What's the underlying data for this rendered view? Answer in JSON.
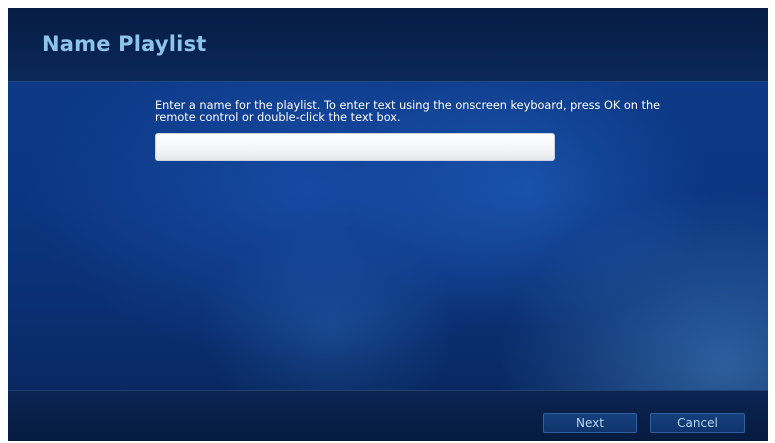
{
  "header": {
    "title": "Name Playlist"
  },
  "main": {
    "instructions": "Enter a name for the playlist. To enter text using the onscreen keyboard, press OK on the remote control or double-click the text box.",
    "name_input": {
      "value": "",
      "placeholder": ""
    }
  },
  "footer": {
    "next_label": "Next",
    "cancel_label": "Cancel"
  },
  "colors": {
    "background": "#0b3580",
    "header_bar": "#061c44",
    "title_text": "#8fc4ea",
    "body_text": "#ffffff",
    "button_text": "#b9d6f2",
    "button_border": "#2f5f9e"
  }
}
